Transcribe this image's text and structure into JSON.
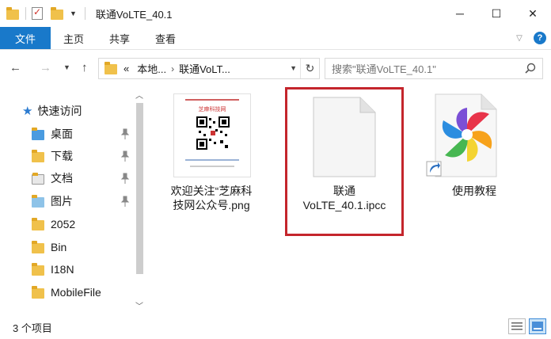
{
  "window": {
    "title": "联通VoLTE_40.1",
    "minimize_glyph": "─",
    "maximize_glyph": "☐",
    "close_glyph": "✕"
  },
  "ribbon": {
    "file_tab": "文件",
    "tabs": [
      "主页",
      "共享",
      "查看"
    ]
  },
  "address": {
    "prefix": "«",
    "crumbs": [
      "本地...",
      "联通VoLT..."
    ],
    "search_placeholder": "搜索\"联通VoLTE_40.1\""
  },
  "sidebar": {
    "quick_access": "快速访问",
    "items": [
      {
        "label": "桌面",
        "pinned": true,
        "icon": "desktop-folder-icon"
      },
      {
        "label": "下载",
        "pinned": true,
        "icon": "downloads-folder-icon"
      },
      {
        "label": "文档",
        "pinned": true,
        "icon": "documents-folder-icon"
      },
      {
        "label": "图片",
        "pinned": true,
        "icon": "pictures-folder-icon"
      },
      {
        "label": "2052",
        "pinned": false,
        "icon": "folder-icon"
      },
      {
        "label": "Bin",
        "pinned": false,
        "icon": "folder-icon"
      },
      {
        "label": "I18N",
        "pinned": false,
        "icon": "folder-icon"
      },
      {
        "label": "MobileFile",
        "pinned": false,
        "icon": "folder-icon"
      }
    ]
  },
  "files": [
    {
      "line1": "欢迎关注“芝麻科",
      "line2": "技网公众号.png",
      "icon": "image-thumbnail-icon",
      "thumb_brand": "芝麻科技网",
      "selected": false
    },
    {
      "line1": "联通",
      "line2": "VoLTE_40.1.ipcc",
      "icon": "blank-file-icon",
      "selected": true
    },
    {
      "line1": "使用教程",
      "line2": "",
      "icon": "pinwheel-shortcut-icon",
      "selected": false
    }
  ],
  "status": {
    "count_text": "3 个项目"
  },
  "colors": {
    "accent": "#1979ca",
    "selection_border": "#c4252c",
    "folder": "#f0c14b"
  }
}
